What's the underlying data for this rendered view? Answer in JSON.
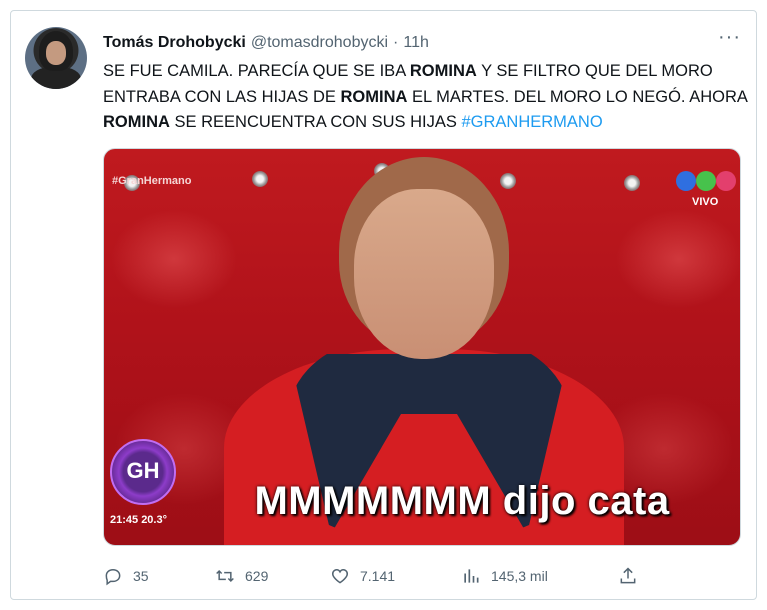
{
  "tweet": {
    "author_name": "Tomás Drohobycki",
    "handle": "@tomasdrohobycki",
    "separator": "·",
    "time": "11h",
    "more_label": "···",
    "text_parts": [
      {
        "t": "SE FUE CAMILA. PARECÍA QUE SE IBA ",
        "style": "normal"
      },
      {
        "t": "ROMINA",
        "style": "bold"
      },
      {
        "t": " Y SE FILTRO QUE DEL MORO ENTRABA CON LAS HIJAS DE ",
        "style": "normal"
      },
      {
        "t": "ROMINA",
        "style": "bold"
      },
      {
        "t": " EL MARTES. DEL MORO LO NEGÓ. AHORA ",
        "style": "normal"
      },
      {
        "t": "ROMINA",
        "style": "bold"
      },
      {
        "t": " SE REENCUENTRA CON SUS HIJAS ",
        "style": "normal"
      },
      {
        "t": "#GRANHERMANO",
        "style": "hashtag"
      }
    ]
  },
  "media": {
    "hashtag_overlay": "#GranHermano",
    "live_label": "VIVO",
    "show_logo_text": "GH",
    "clock": "21:45  20.3°",
    "caption": "MMMMMMM dijo cata"
  },
  "actions": {
    "replies": "35",
    "retweets": "629",
    "likes": "7.141",
    "views": "145,3 mil"
  },
  "icons": [
    "reply-icon",
    "retweet-icon",
    "like-icon",
    "views-icon",
    "share-icon",
    "more-icon"
  ],
  "colors": {
    "hashtag": "#1d9bf0",
    "secondary_text": "#536471",
    "media_bg": "#c01a1f"
  }
}
